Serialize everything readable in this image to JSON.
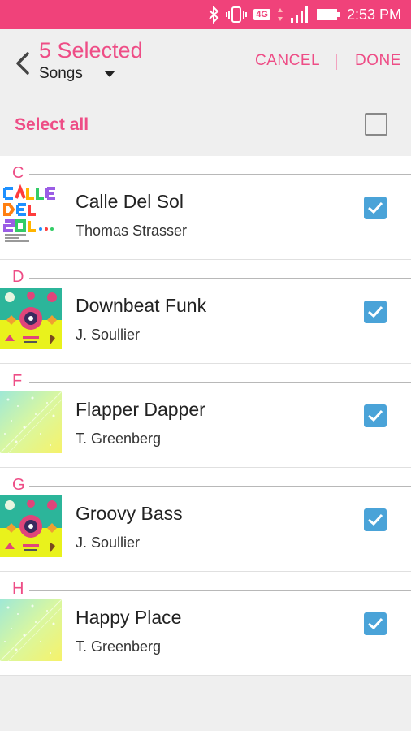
{
  "status": {
    "time": "2:53 PM",
    "network": "4G"
  },
  "header": {
    "title": "5 Selected",
    "subtitle": "Songs",
    "cancel": "CANCEL",
    "done": "DONE"
  },
  "select_all": {
    "label": "Select all",
    "checked": false
  },
  "sections": [
    {
      "letter": "C",
      "song": {
        "title": "Calle Del Sol",
        "artist": "Thomas Strasser",
        "cover": "calle-del-sol-cover",
        "checked": true
      }
    },
    {
      "letter": "D",
      "song": {
        "title": "Downbeat Funk",
        "artist": "J. Soullier",
        "cover": "groovy-bass-cover",
        "checked": true
      }
    },
    {
      "letter": "F",
      "song": {
        "title": "Flapper Dapper",
        "artist": "T. Greenberg",
        "cover": "sparkle-cover",
        "checked": true
      }
    },
    {
      "letter": "G",
      "song": {
        "title": "Groovy Bass",
        "artist": "J. Soullier",
        "cover": "groovy-bass-cover",
        "checked": true
      }
    },
    {
      "letter": "H",
      "song": {
        "title": "Happy Place",
        "artist": "T. Greenberg",
        "cover": "sparkle-cover",
        "checked": true
      }
    }
  ],
  "colors": {
    "accent": "#ee4d86",
    "statusbar": "#f0427a",
    "checkbox": "#4aa3d8"
  }
}
